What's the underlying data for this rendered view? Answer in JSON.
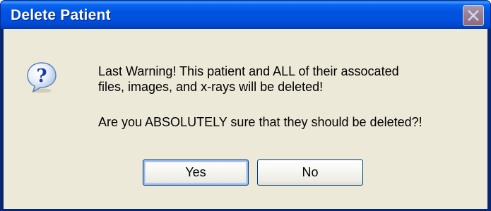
{
  "window": {
    "title": "Delete Patient"
  },
  "message": {
    "line1": "Last Warning!  This patient and ALL of their assocated",
    "line2": "files, images, and x-rays will be deleted!",
    "line3": "Are you ABSOLUTELY sure that they should be deleted?!"
  },
  "icons": {
    "dialog_icon": "question-icon",
    "close": "close-icon"
  },
  "buttons": {
    "yes_label": "Yes",
    "no_label": "No"
  },
  "colors": {
    "titlebar_blue": "#0053e0",
    "dialog_face": "#ece9d8",
    "button_border": "#003c74"
  }
}
